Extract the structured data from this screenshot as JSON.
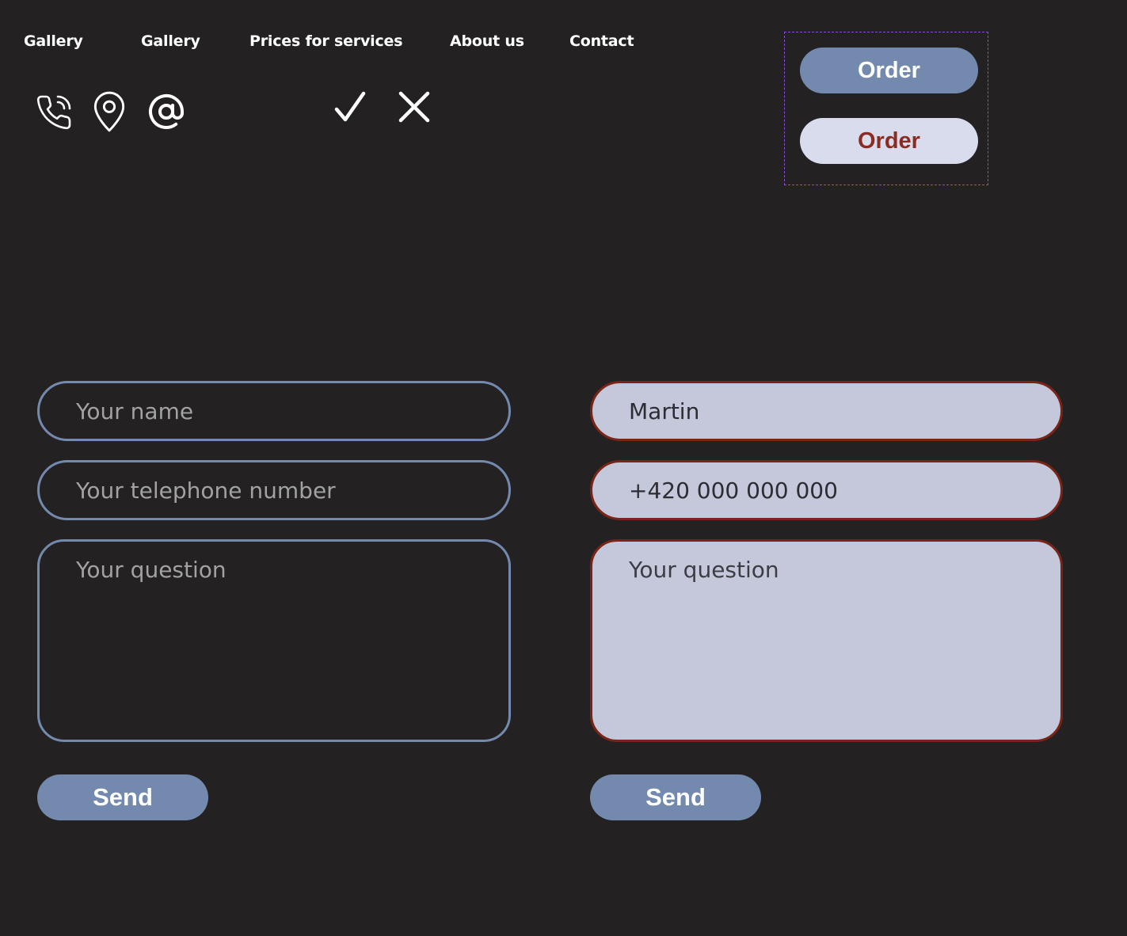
{
  "nav": {
    "items": [
      "Gallery",
      "Gallery",
      "Prices for services",
      "About us",
      "Contact"
    ]
  },
  "icons": {
    "contacts": [
      "phone-icon",
      "map-pin-icon",
      "at-sign-icon"
    ],
    "status": [
      "checkmark-icon",
      "close-icon"
    ]
  },
  "order_buttons": {
    "primary_label": "Order",
    "secondary_label": "Order"
  },
  "form_empty": {
    "name_placeholder": "Your name",
    "phone_placeholder": "Your telephone number",
    "question_placeholder": "Your question",
    "send_label": "Send"
  },
  "form_filled": {
    "name_value": "Martin",
    "phone_value": "+420 000 000 000",
    "question_placeholder": "Your question",
    "send_label": "Send"
  },
  "colors": {
    "background": "#232122",
    "accent": "#738aae",
    "filled_field": "#c4c8da",
    "error_border": "#7a2418",
    "secondary_button": "#d8dcec",
    "secondary_button_text": "#8b2c22",
    "frame_dashed": "#8a4bdc"
  }
}
